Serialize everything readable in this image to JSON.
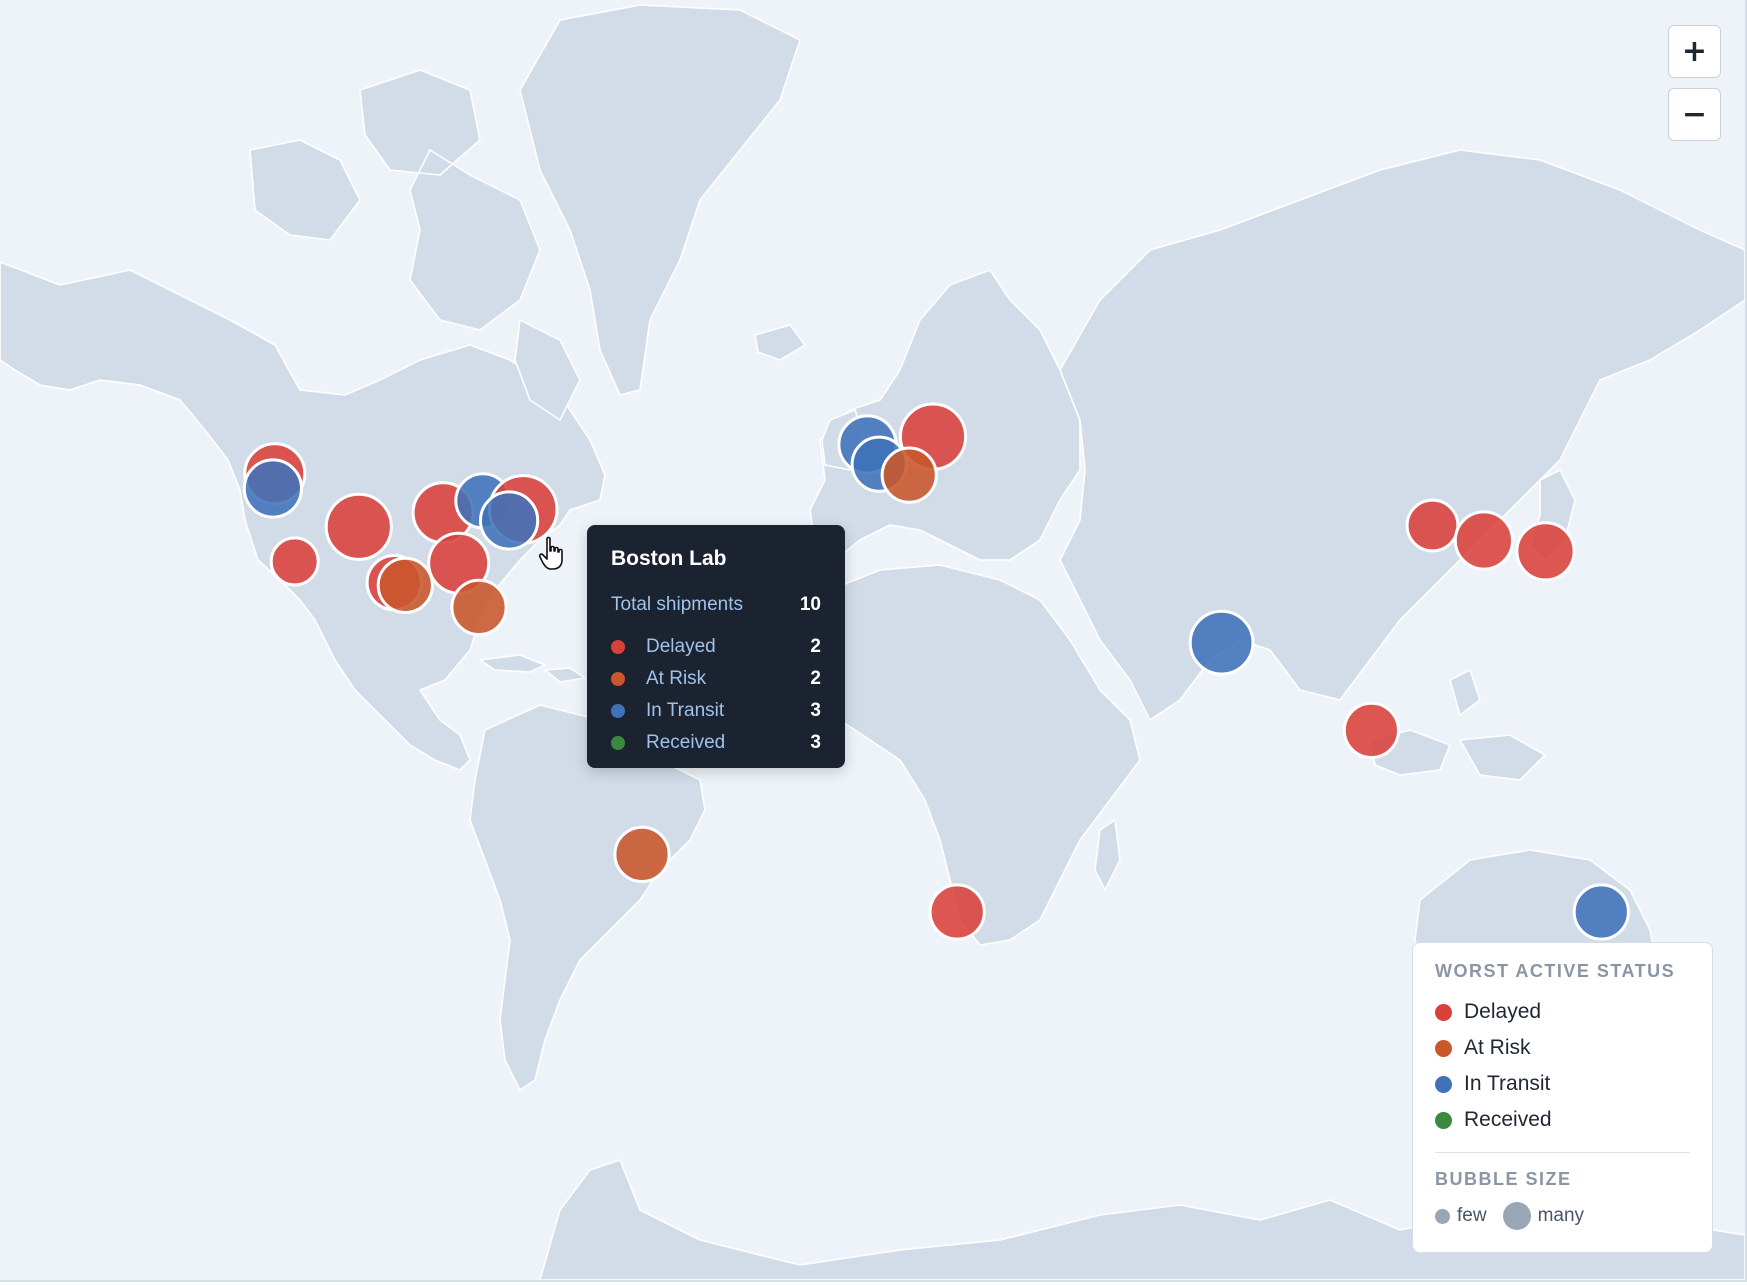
{
  "zoom": {
    "in_label": "+",
    "out_label": "−"
  },
  "status_colors": {
    "Delayed": "#d9403a",
    "At Risk": "#c8572a",
    "In Transit": "#3f72b8",
    "Received": "#3a8a3e"
  },
  "tooltip": {
    "title": "Boston Lab",
    "total_label": "Total shipments",
    "total_value": "10",
    "rows": [
      {
        "label": "Delayed",
        "value": "2",
        "color": "#d9403a"
      },
      {
        "label": "At Risk",
        "value": "2",
        "color": "#c8572a"
      },
      {
        "label": "In Transit",
        "value": "3",
        "color": "#3f72b8"
      },
      {
        "label": "Received",
        "value": "3",
        "color": "#3a8a3e"
      }
    ]
  },
  "legend": {
    "status_heading": "WORST ACTIVE STATUS",
    "items": [
      {
        "label": "Delayed",
        "color": "#d9403a"
      },
      {
        "label": "At Risk",
        "color": "#c8572a"
      },
      {
        "label": "In Transit",
        "color": "#3f72b8"
      },
      {
        "label": "Received",
        "color": "#3a8a3e"
      }
    ],
    "size_heading": "BUBBLE SIZE",
    "size_few": "few",
    "size_many": "many"
  },
  "locations": [
    {
      "lat": 47.6,
      "lon": -122.3,
      "status": "Delayed",
      "shipments": 7
    },
    {
      "lat": 45.5,
      "lon": -122.7,
      "status": "In Transit",
      "shipments": 6
    },
    {
      "lat": 39.7,
      "lon": -105.0,
      "status": "Delayed",
      "shipments": 9
    },
    {
      "lat": 34.0,
      "lon": -118.2,
      "status": "Delayed",
      "shipments": 3
    },
    {
      "lat": 30.3,
      "lon": -97.7,
      "status": "Delayed",
      "shipments": 5
    },
    {
      "lat": 29.8,
      "lon": -95.4,
      "status": "At Risk",
      "shipments": 5
    },
    {
      "lat": 41.9,
      "lon": -87.6,
      "status": "Delayed",
      "shipments": 7
    },
    {
      "lat": 33.7,
      "lon": -84.4,
      "status": "Delayed",
      "shipments": 7
    },
    {
      "lat": 25.8,
      "lon": -80.2,
      "status": "At Risk",
      "shipments": 5
    },
    {
      "lat": 43.7,
      "lon": -79.4,
      "status": "In Transit",
      "shipments": 5
    },
    {
      "lat": 42.4,
      "lon": -71.1,
      "status": "Delayed",
      "shipments": 10
    },
    {
      "lat": 40.7,
      "lon": -74.0,
      "status": "In Transit",
      "shipments": 6
    },
    {
      "lat": -23.5,
      "lon": -46.6,
      "status": "At Risk",
      "shipments": 5
    },
    {
      "lat": 51.5,
      "lon": -0.1,
      "status": "In Transit",
      "shipments": 6
    },
    {
      "lat": 48.9,
      "lon": 2.3,
      "status": "In Transit",
      "shipments": 5
    },
    {
      "lat": 52.5,
      "lon": 13.4,
      "status": "Delayed",
      "shipments": 9
    },
    {
      "lat": 47.4,
      "lon": 8.5,
      "status": "At Risk",
      "shipments": 5
    },
    {
      "lat": -33.9,
      "lon": 18.4,
      "status": "Delayed",
      "shipments": 5
    },
    {
      "lat": 19.1,
      "lon": 72.9,
      "status": "In Transit",
      "shipments": 8
    },
    {
      "lat": 1.35,
      "lon": 103.8,
      "status": "Delayed",
      "shipments": 5
    },
    {
      "lat": 39.9,
      "lon": 116.4,
      "status": "Delayed",
      "shipments": 4
    },
    {
      "lat": 37.5,
      "lon": 127.0,
      "status": "Delayed",
      "shipments": 6
    },
    {
      "lat": 35.7,
      "lon": 139.7,
      "status": "Delayed",
      "shipments": 6
    },
    {
      "lat": -33.9,
      "lon": 151.2,
      "status": "In Transit",
      "shipments": 5
    }
  ]
}
